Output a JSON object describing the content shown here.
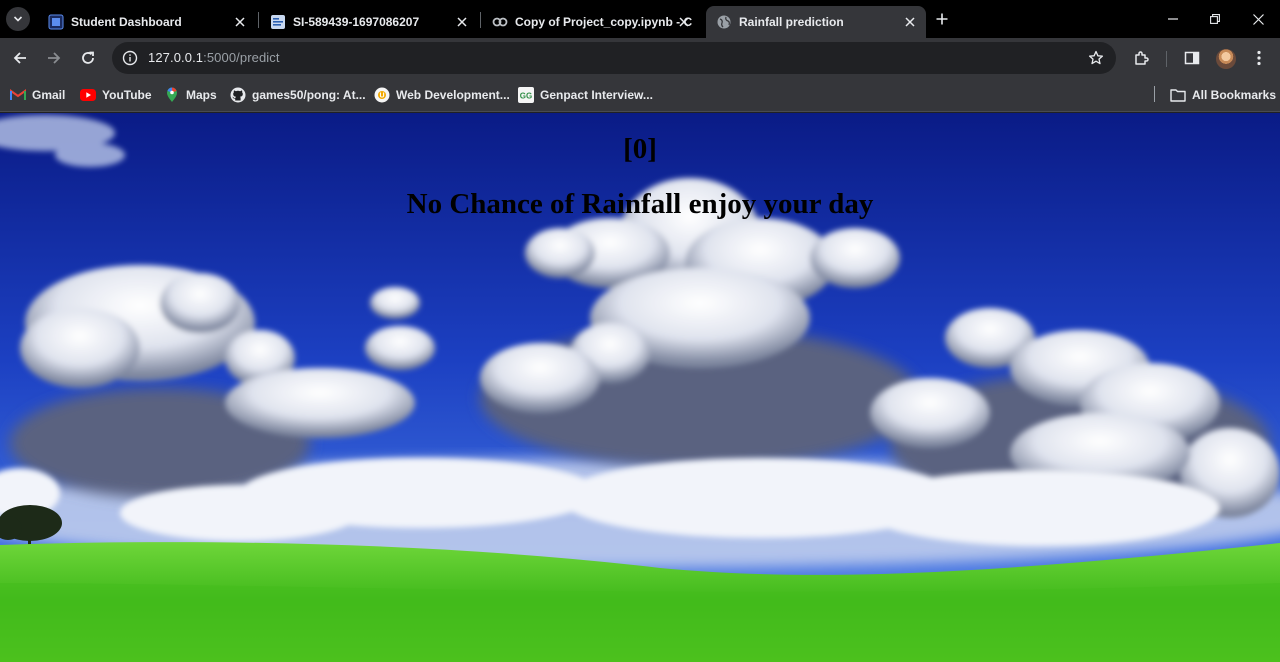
{
  "browser": {
    "tabs": [
      {
        "title": "Student Dashboard",
        "icon": "dashboard-icon",
        "active": false
      },
      {
        "title": "SI-589439-1697086207",
        "icon": "document-icon",
        "active": false
      },
      {
        "title": "Copy of Project_copy.ipynb - C",
        "icon": "colab-icon",
        "active": false
      },
      {
        "title": "Rainfall prediction",
        "icon": "globe-icon",
        "active": true
      }
    ],
    "address": {
      "host": "127.0.0.1",
      "path": ":5000/predict"
    },
    "bookmarks": [
      {
        "label": "Gmail",
        "icon": "gmail-icon"
      },
      {
        "label": "YouTube",
        "icon": "youtube-icon"
      },
      {
        "label": "Maps",
        "icon": "maps-icon"
      },
      {
        "label": "games50/pong: At...",
        "icon": "github-icon"
      },
      {
        "label": "Web Development...",
        "icon": "web-dev-icon"
      },
      {
        "label": "Genpact Interview...",
        "icon": "geeksforgeeks-icon"
      }
    ],
    "all_bookmarks_label": "All Bookmarks"
  },
  "page": {
    "prediction_value": "[0]",
    "prediction_message": "No Chance of Rainfall enjoy your day"
  },
  "colors": {
    "sky_top": "#0b1f8f",
    "sky_mid": "#1f46c8",
    "grass": "#4fc41a",
    "text": "#000000"
  }
}
